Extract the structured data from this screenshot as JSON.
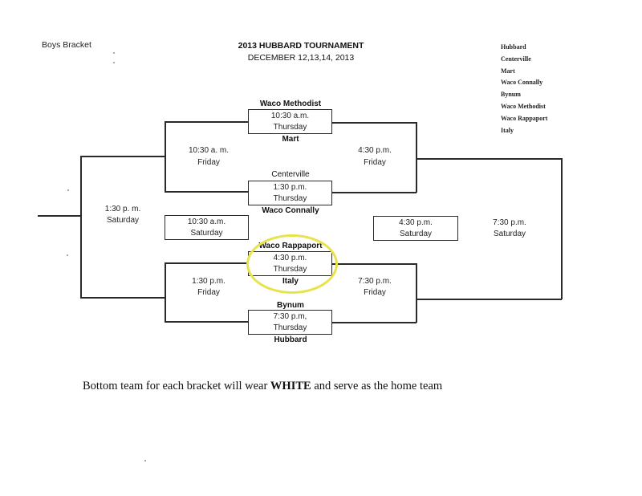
{
  "header": {
    "bracket_label": "Boys Bracket",
    "title": "2013 HUBBARD TOURNAMENT",
    "dates": "DECEMBER 12,13,14, 2013"
  },
  "team_list": [
    "Hubbard",
    "Centerville",
    "Mart",
    "Waco Connally",
    "Bynum",
    "Waco Methodist",
    "Waco Rappaport",
    "Italy"
  ],
  "first_round": [
    {
      "top_team": "Waco Methodist",
      "time": "10:30 a.m.",
      "day": "Thursday",
      "bottom_team": "Mart"
    },
    {
      "top_team": "Centerville",
      "time": "1:30 p.m.",
      "day": "Thursday",
      "bottom_team": "Waco Connally"
    },
    {
      "top_team": "Waco Rappaport",
      "time": "4:30 p.m.",
      "day": "Thursday",
      "bottom_team": "Italy"
    },
    {
      "top_team": "Bynum",
      "time": "7:30 p.m,",
      "day": "Thursday",
      "bottom_team": "Hubbard"
    }
  ],
  "consolation_semis": [
    {
      "time": "10:30 a. m.",
      "day": "Friday"
    },
    {
      "time": "1:30 p.m.",
      "day": "Friday"
    }
  ],
  "winner_semis": [
    {
      "time": "4:30 p.m.",
      "day": "Friday"
    },
    {
      "time": "7:30 p.m.",
      "day": "Friday"
    }
  ],
  "saturday_games": {
    "consolation_final": {
      "time": "1:30 p. m.",
      "day": "Saturday"
    },
    "left_middle": {
      "time": "10:30 a.m.",
      "day": "Saturday"
    },
    "right_middle": {
      "time": "4:30 p.m.",
      "day": "Saturday"
    },
    "championship": {
      "time": "7:30 p.m.",
      "day": "Saturday"
    }
  },
  "footer": {
    "before": "Bottom team for each bracket will wear ",
    "emphasis": "WHITE",
    "after": " and serve as the home team"
  },
  "highlight_color": "#e8e34a"
}
